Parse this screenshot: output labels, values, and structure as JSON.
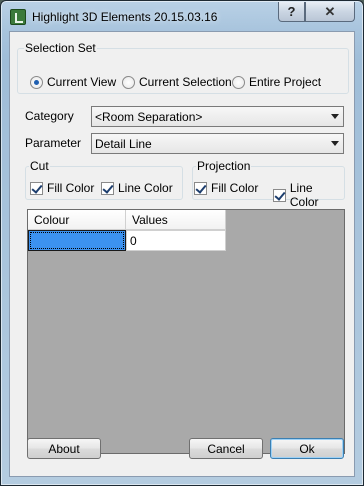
{
  "window": {
    "title": "Highlight 3D Elements 20.15.03.16",
    "help_label": "?",
    "close_label": "✕"
  },
  "selection_set": {
    "label": "Selection Set",
    "options": [
      {
        "label": "Current View",
        "checked": true
      },
      {
        "label": "Current Selection",
        "checked": false
      },
      {
        "label": "Entire Project",
        "checked": false
      }
    ]
  },
  "category": {
    "label": "Category",
    "value": "<Room Separation>"
  },
  "parameter": {
    "label": "Parameter",
    "value": "Detail Line"
  },
  "cut": {
    "label": "Cut",
    "fill_color": {
      "label": "Fill Color",
      "checked": true
    },
    "line_color": {
      "label": "Line Color",
      "checked": true
    }
  },
  "projection": {
    "label": "Projection",
    "fill_color": {
      "label": "Fill Color",
      "checked": true
    },
    "line_color": {
      "label": "Line Color",
      "checked": true
    }
  },
  "grid": {
    "columns": [
      "Colour",
      "Values"
    ],
    "rows": [
      {
        "colour": "#3c92f0",
        "value": "0"
      }
    ]
  },
  "buttons": {
    "about": "About",
    "cancel": "Cancel",
    "ok": "Ok"
  }
}
